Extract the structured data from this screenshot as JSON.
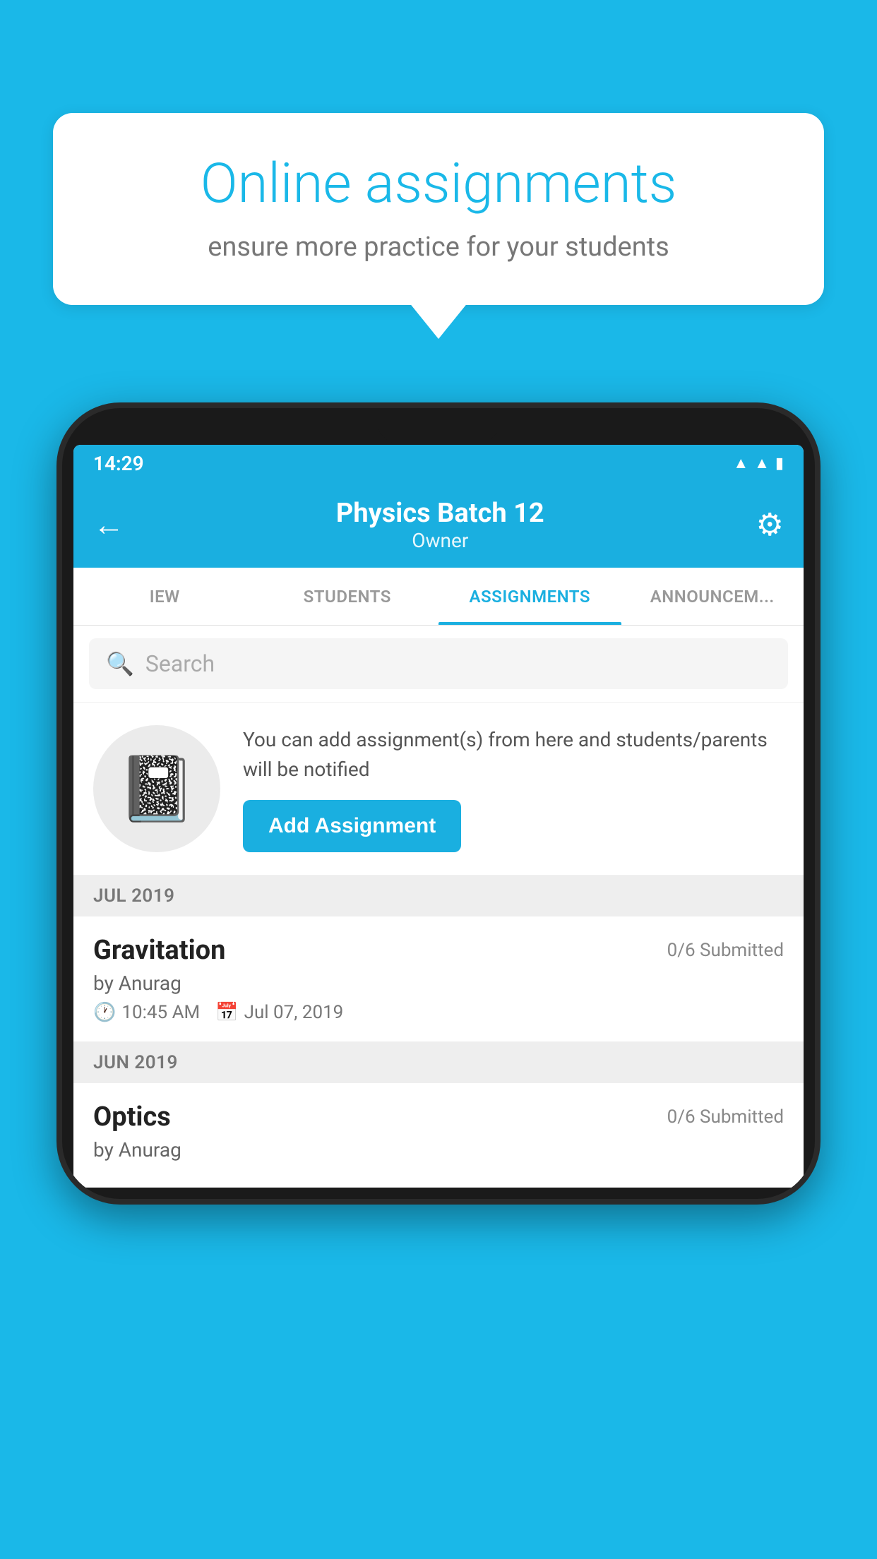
{
  "background_color": "#1ab8e8",
  "speech_bubble": {
    "title": "Online assignments",
    "subtitle": "ensure more practice for your students"
  },
  "phone": {
    "status_bar": {
      "time": "14:29",
      "icons": [
        "wifi",
        "signal",
        "battery"
      ]
    },
    "header": {
      "title": "Physics Batch 12",
      "subtitle": "Owner",
      "back_label": "←",
      "settings_label": "⚙"
    },
    "tabs": [
      {
        "label": "IEW",
        "active": false
      },
      {
        "label": "STUDENTS",
        "active": false
      },
      {
        "label": "ASSIGNMENTS",
        "active": true
      },
      {
        "label": "ANNOUNCEM...",
        "active": false
      }
    ],
    "search": {
      "placeholder": "Search"
    },
    "promo": {
      "text": "You can add assignment(s) from here and students/parents will be notified",
      "button_label": "Add Assignment"
    },
    "sections": [
      {
        "header": "JUL 2019",
        "assignments": [
          {
            "name": "Gravitation",
            "submitted": "0/6 Submitted",
            "by": "by Anurag",
            "time": "10:45 AM",
            "date": "Jul 07, 2019"
          }
        ]
      },
      {
        "header": "JUN 2019",
        "assignments": [
          {
            "name": "Optics",
            "submitted": "0/6 Submitted",
            "by": "by Anurag",
            "time": "",
            "date": ""
          }
        ]
      }
    ]
  }
}
